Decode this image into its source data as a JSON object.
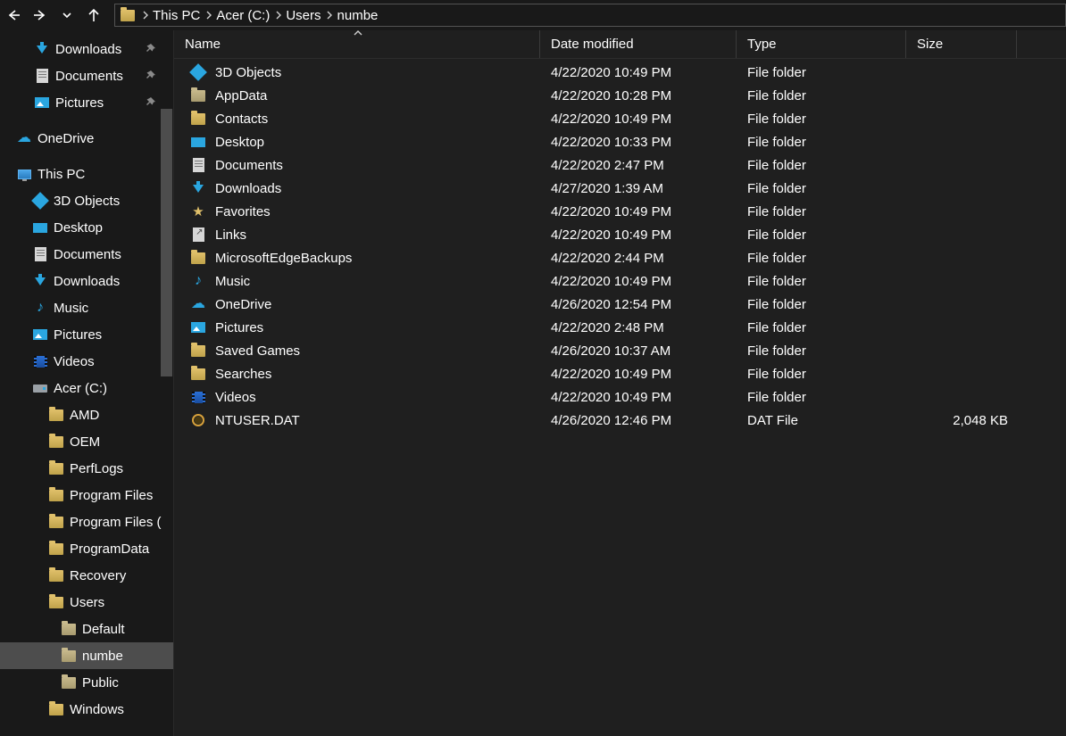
{
  "breadcrumb": {
    "items": [
      {
        "label": "This PC"
      },
      {
        "label": "Acer (C:)"
      },
      {
        "label": "Users"
      },
      {
        "label": "numbe"
      }
    ]
  },
  "columns": {
    "name": "Name",
    "date": "Date modified",
    "type": "Type",
    "size": "Size"
  },
  "nav": {
    "quick": [
      {
        "label": "Downloads",
        "icon": "download-icon",
        "pinned": true
      },
      {
        "label": "Documents",
        "icon": "document-icon",
        "pinned": true
      },
      {
        "label": "Pictures",
        "icon": "pictures-icon",
        "pinned": true
      }
    ],
    "onedrive": {
      "label": "OneDrive"
    },
    "thispc": {
      "label": "This PC",
      "children": [
        {
          "label": "3D Objects",
          "icon": "3d-icon"
        },
        {
          "label": "Desktop",
          "icon": "desktop-icon"
        },
        {
          "label": "Documents",
          "icon": "document-icon"
        },
        {
          "label": "Downloads",
          "icon": "download-icon"
        },
        {
          "label": "Music",
          "icon": "music-icon"
        },
        {
          "label": "Pictures",
          "icon": "pictures-icon"
        },
        {
          "label": "Videos",
          "icon": "video-icon"
        }
      ],
      "drive": {
        "label": "Acer (C:)",
        "children": [
          {
            "label": "AMD"
          },
          {
            "label": "OEM"
          },
          {
            "label": "PerfLogs"
          },
          {
            "label": "Program Files"
          },
          {
            "label": "Program Files ("
          },
          {
            "label": "ProgramData"
          },
          {
            "label": "Recovery"
          }
        ],
        "users": {
          "label": "Users",
          "children": [
            {
              "label": "Default"
            },
            {
              "label": "numbe",
              "selected": true
            },
            {
              "label": "Public"
            }
          ]
        },
        "windows": {
          "label": "Windows"
        }
      }
    }
  },
  "files": [
    {
      "name": "3D Objects",
      "date": "4/22/2020 10:49 PM",
      "type": "File folder",
      "size": "",
      "icon": "3d-icon"
    },
    {
      "name": "AppData",
      "date": "4/22/2020 10:28 PM",
      "type": "File folder",
      "size": "",
      "icon": "folder-dim-icon"
    },
    {
      "name": "Contacts",
      "date": "4/22/2020 10:49 PM",
      "type": "File folder",
      "size": "",
      "icon": "folder-icon"
    },
    {
      "name": "Desktop",
      "date": "4/22/2020 10:33 PM",
      "type": "File folder",
      "size": "",
      "icon": "desktop-icon"
    },
    {
      "name": "Documents",
      "date": "4/22/2020 2:47 PM",
      "type": "File folder",
      "size": "",
      "icon": "document-icon"
    },
    {
      "name": "Downloads",
      "date": "4/27/2020 1:39 AM",
      "type": "File folder",
      "size": "",
      "icon": "download-icon"
    },
    {
      "name": "Favorites",
      "date": "4/22/2020 10:49 PM",
      "type": "File folder",
      "size": "",
      "icon": "favorites-icon"
    },
    {
      "name": "Links",
      "date": "4/22/2020 10:49 PM",
      "type": "File folder",
      "size": "",
      "icon": "links-icon"
    },
    {
      "name": "MicrosoftEdgeBackups",
      "date": "4/22/2020 2:44 PM",
      "type": "File folder",
      "size": "",
      "icon": "folder-icon"
    },
    {
      "name": "Music",
      "date": "4/22/2020 10:49 PM",
      "type": "File folder",
      "size": "",
      "icon": "music-icon"
    },
    {
      "name": "OneDrive",
      "date": "4/26/2020 12:54 PM",
      "type": "File folder",
      "size": "",
      "icon": "onedrive-icon"
    },
    {
      "name": "Pictures",
      "date": "4/22/2020 2:48 PM",
      "type": "File folder",
      "size": "",
      "icon": "pictures-folder-icon"
    },
    {
      "name": "Saved Games",
      "date": "4/26/2020 10:37 AM",
      "type": "File folder",
      "size": "",
      "icon": "games-icon"
    },
    {
      "name": "Searches",
      "date": "4/22/2020 10:49 PM",
      "type": "File folder",
      "size": "",
      "icon": "search-folder-icon"
    },
    {
      "name": "Videos",
      "date": "4/22/2020 10:49 PM",
      "type": "File folder",
      "size": "",
      "icon": "video-icon"
    },
    {
      "name": "NTUSER.DAT",
      "date": "4/26/2020 12:46 PM",
      "type": "DAT File",
      "size": "2,048 KB",
      "icon": "dat-icon"
    }
  ]
}
